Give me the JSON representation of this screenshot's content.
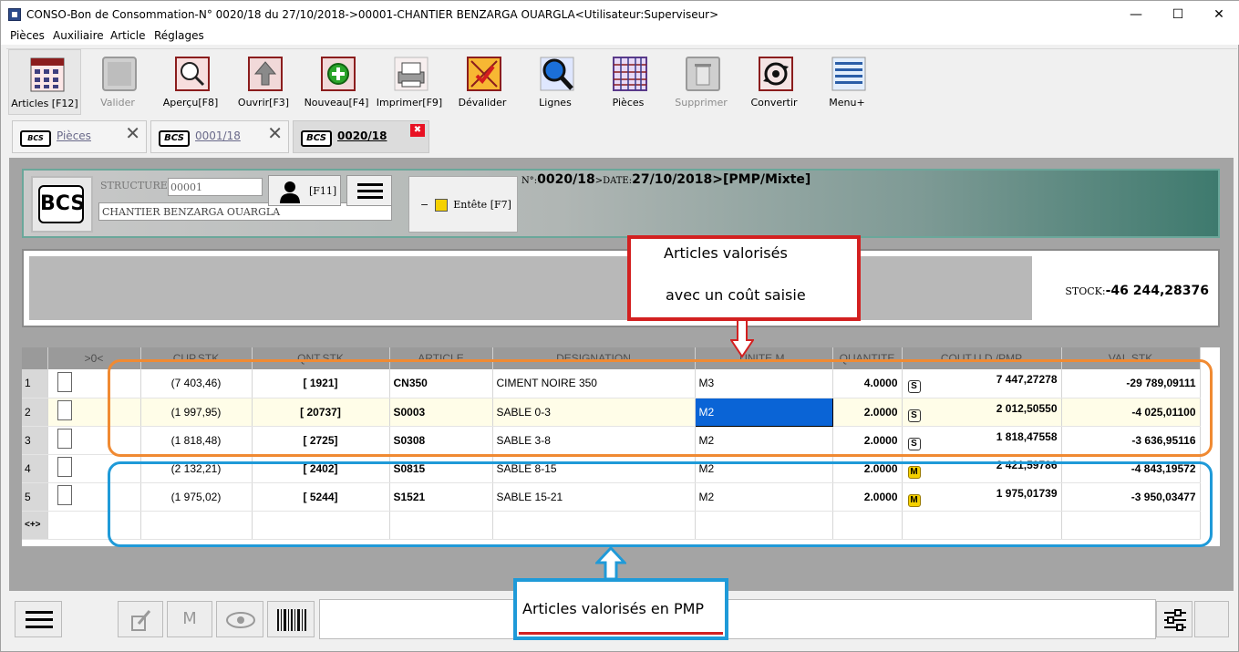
{
  "window": {
    "title": "CONSO-Bon de Consommation-N° 0020/18 du 27/10/2018->00001-CHANTIER BENZARGA OUARGLA<Utilisateur:Superviseur>",
    "minimize": "—",
    "maximize": "☐",
    "close": "✕"
  },
  "menu": [
    "Pièces",
    "Auxiliaire",
    "Article",
    "Réglages"
  ],
  "toolbar": [
    {
      "label": "Articles [F12]",
      "icon": "articles-grid-icon",
      "enabled": true
    },
    {
      "label": "Valider",
      "icon": "validate-icon",
      "enabled": false
    },
    {
      "label": "Aperçu[F8]",
      "icon": "preview-magnifier-icon",
      "enabled": true
    },
    {
      "label": "Ouvrir[F3]",
      "icon": "open-arrow-icon",
      "enabled": true
    },
    {
      "label": "Nouveau[F4]",
      "icon": "new-plus-icon",
      "enabled": true
    },
    {
      "label": "Imprimer[F9]",
      "icon": "printer-icon",
      "enabled": true
    },
    {
      "label": "Dévalider",
      "icon": "devalidate-icon",
      "enabled": true
    },
    {
      "label": "Lignes",
      "icon": "lines-search-icon",
      "enabled": true
    },
    {
      "label": "Pièces",
      "icon": "pieces-grid-icon",
      "enabled": true
    },
    {
      "label": "Supprimer",
      "icon": "trash-icon",
      "enabled": false
    },
    {
      "label": "Convertir",
      "icon": "convert-gear-icon",
      "enabled": true
    },
    {
      "label": "Menu+",
      "icon": "menu-lines-icon",
      "enabled": true
    }
  ],
  "tabs": [
    {
      "label": "Pièces",
      "badge": "",
      "close": "✕"
    },
    {
      "label": "0001/18",
      "badge": "BCS",
      "close": "✕"
    },
    {
      "label": "0020/18",
      "badge": "BCS",
      "close": "✖"
    }
  ],
  "tab0_badge": "BCS",
  "header": {
    "logo": "BCS",
    "structure_label": "STRUCTURE",
    "structure_code": "00001",
    "structure_name": "CHANTIER BENZARGA OUARGLA",
    "f11_label": "[F11]",
    "entete_label": "Entête [F7]",
    "entete_toggle": "−",
    "no_label": "N°:",
    "no_value": "0020/18",
    "date_label": ">DATE:",
    "date_value": "27/10/2018",
    "mode_value": ">[PMP/Mixte]"
  },
  "stock": {
    "label": "STOCK:",
    "value": "-46 244,28376"
  },
  "grid": {
    "columns": [
      ">0<",
      "CUP.STK",
      "QNT.STK",
      "ARTICLE",
      "DESIGNATION",
      "UNITE M.",
      "QUANTITE",
      "COUT.U.D./PMP",
      "VAL.STK"
    ],
    "rows": [
      {
        "n": "1",
        "cup": "(7 403,46)",
        "qnt": "[ 1921]",
        "article": "CN350",
        "designation": "CIMENT NOIRE 350",
        "unite": "M3",
        "quantite": "4.0000",
        "flag": "S",
        "cout": "7 447,27278",
        "val": "-29 789,09111"
      },
      {
        "n": "2",
        "cup": "(1 997,95)",
        "qnt": "[ 20737]",
        "article": "S0003",
        "designation": "SABLE 0-3",
        "unite": "M2",
        "quantite": "2.0000",
        "flag": "S",
        "cout": "2 012,50550",
        "val": "-4 025,01100"
      },
      {
        "n": "3",
        "cup": "(1 818,48)",
        "qnt": "[ 2725]",
        "article": "S0308",
        "designation": "SABLE 3-8",
        "unite": "M2",
        "quantite": "2.0000",
        "flag": "S",
        "cout": "1 818,47558",
        "val": "-3 636,95116"
      },
      {
        "n": "4",
        "cup": "(2 132,21)",
        "qnt": "[ 2402]",
        "article": "S0815",
        "designation": "SABLE 8-15",
        "unite": "M2",
        "quantite": "2.0000",
        "flag": "M",
        "cout": "2 421,59786",
        "val": "-4 843,19572"
      },
      {
        "n": "5",
        "cup": "(1 975,02)",
        "qnt": "[ 5244]",
        "article": "S1521",
        "designation": "SABLE 15-21",
        "unite": "M2",
        "quantite": "2.0000",
        "flag": "M",
        "cout": "1 975,01739",
        "val": "-3 950,03477"
      }
    ],
    "new_row_marker": "<+>"
  },
  "bottom": {
    "m_label": "M"
  },
  "annotations": {
    "red_line1": "Articles valorisés",
    "red_line2": "avec un coût saisie",
    "blue_line": "Articles valorisés en PMP"
  }
}
